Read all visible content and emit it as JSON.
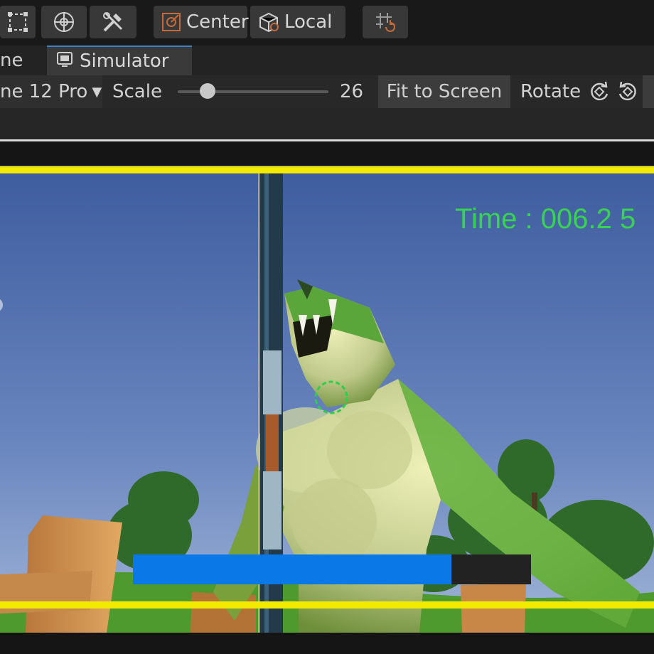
{
  "toolbar": {
    "pivot_label": "Center",
    "space_label": "Local"
  },
  "tabs": {
    "game_label": "ne",
    "simulator_label": "Simulator"
  },
  "simulator": {
    "device_label": "ne 12 Pro",
    "scale_label": "Scale",
    "scale_value": "26",
    "scale_fraction": 0.2,
    "fit_label": "Fit to Screen",
    "rotate_label": "Rotate"
  },
  "game": {
    "time_text": "Time : 006.2  5",
    "health_fraction": 0.8
  },
  "colors": {
    "safe_area": "#f2ea00",
    "health_bar": "#0a78e6",
    "hud_text": "#39d353",
    "tab_accent": "#3a7fc4"
  }
}
